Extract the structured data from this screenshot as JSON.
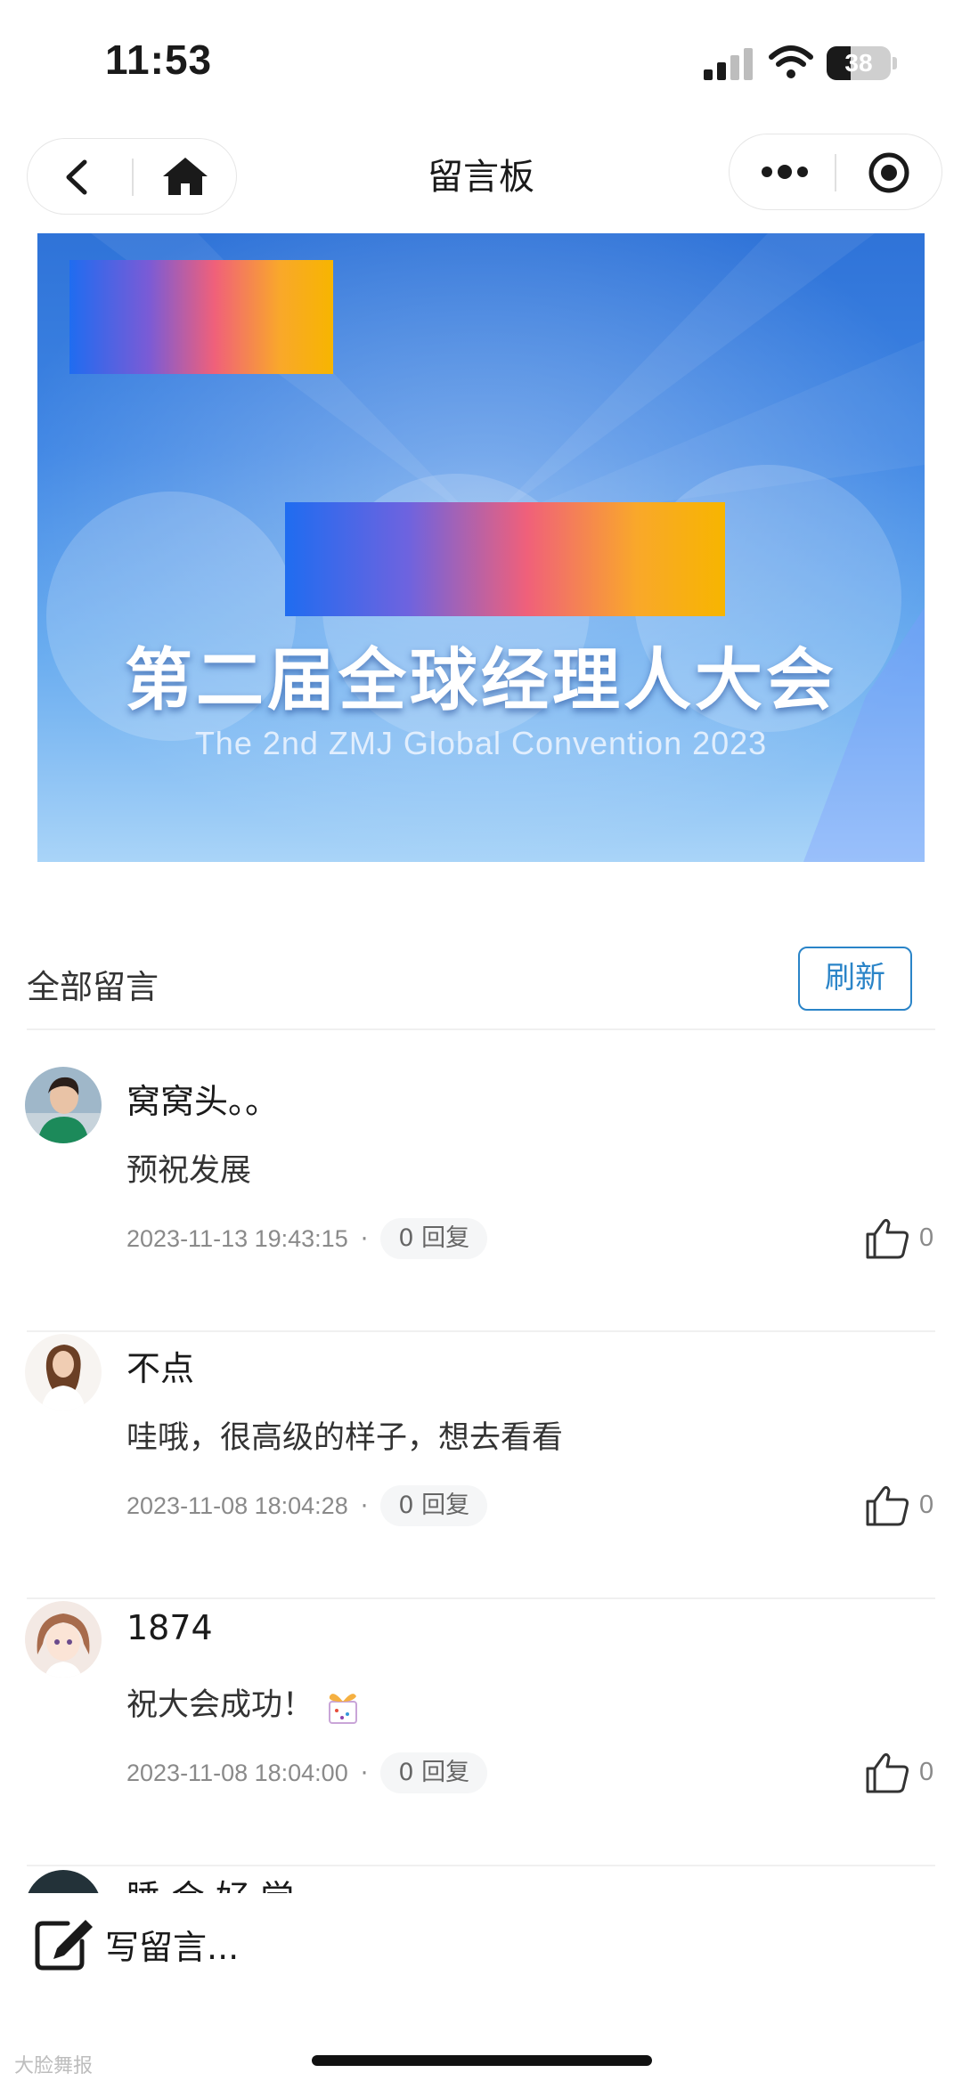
{
  "status_bar": {
    "time": "11:53",
    "battery": "38",
    "battery_level": 0.38
  },
  "nav": {
    "title": "留言板"
  },
  "banner": {
    "title": "第二届全球经理人大会",
    "subtitle": "The 2nd  ZMJ Global Convention 2023"
  },
  "section": {
    "title": "全部留言",
    "refresh_label": "刷新"
  },
  "comments": [
    {
      "name": "窝窝头。。",
      "text": "预祝发展",
      "date": "2023-11-13 19:43:15",
      "replies": "0 回复",
      "likes": "0"
    },
    {
      "name": "不点",
      "text": "哇哦，很高级的样子，想去看看",
      "date": "2023-11-08 18:04:28",
      "replies": "0 回复",
      "likes": "0"
    },
    {
      "name": "1874",
      "text": "祝大会成功！",
      "date": "2023-11-08 18:04:00",
      "replies": "0 回复",
      "likes": "0"
    }
  ],
  "partial_comment": {
    "name": "睡 会 好 觉"
  },
  "compose": {
    "placeholder": "写留言..."
  },
  "watermark": "大脸舞报",
  "colors": {
    "accent": "#2a84c8",
    "banner_top": "#2f73d8",
    "banner_bottom": "#a9d4f8"
  }
}
